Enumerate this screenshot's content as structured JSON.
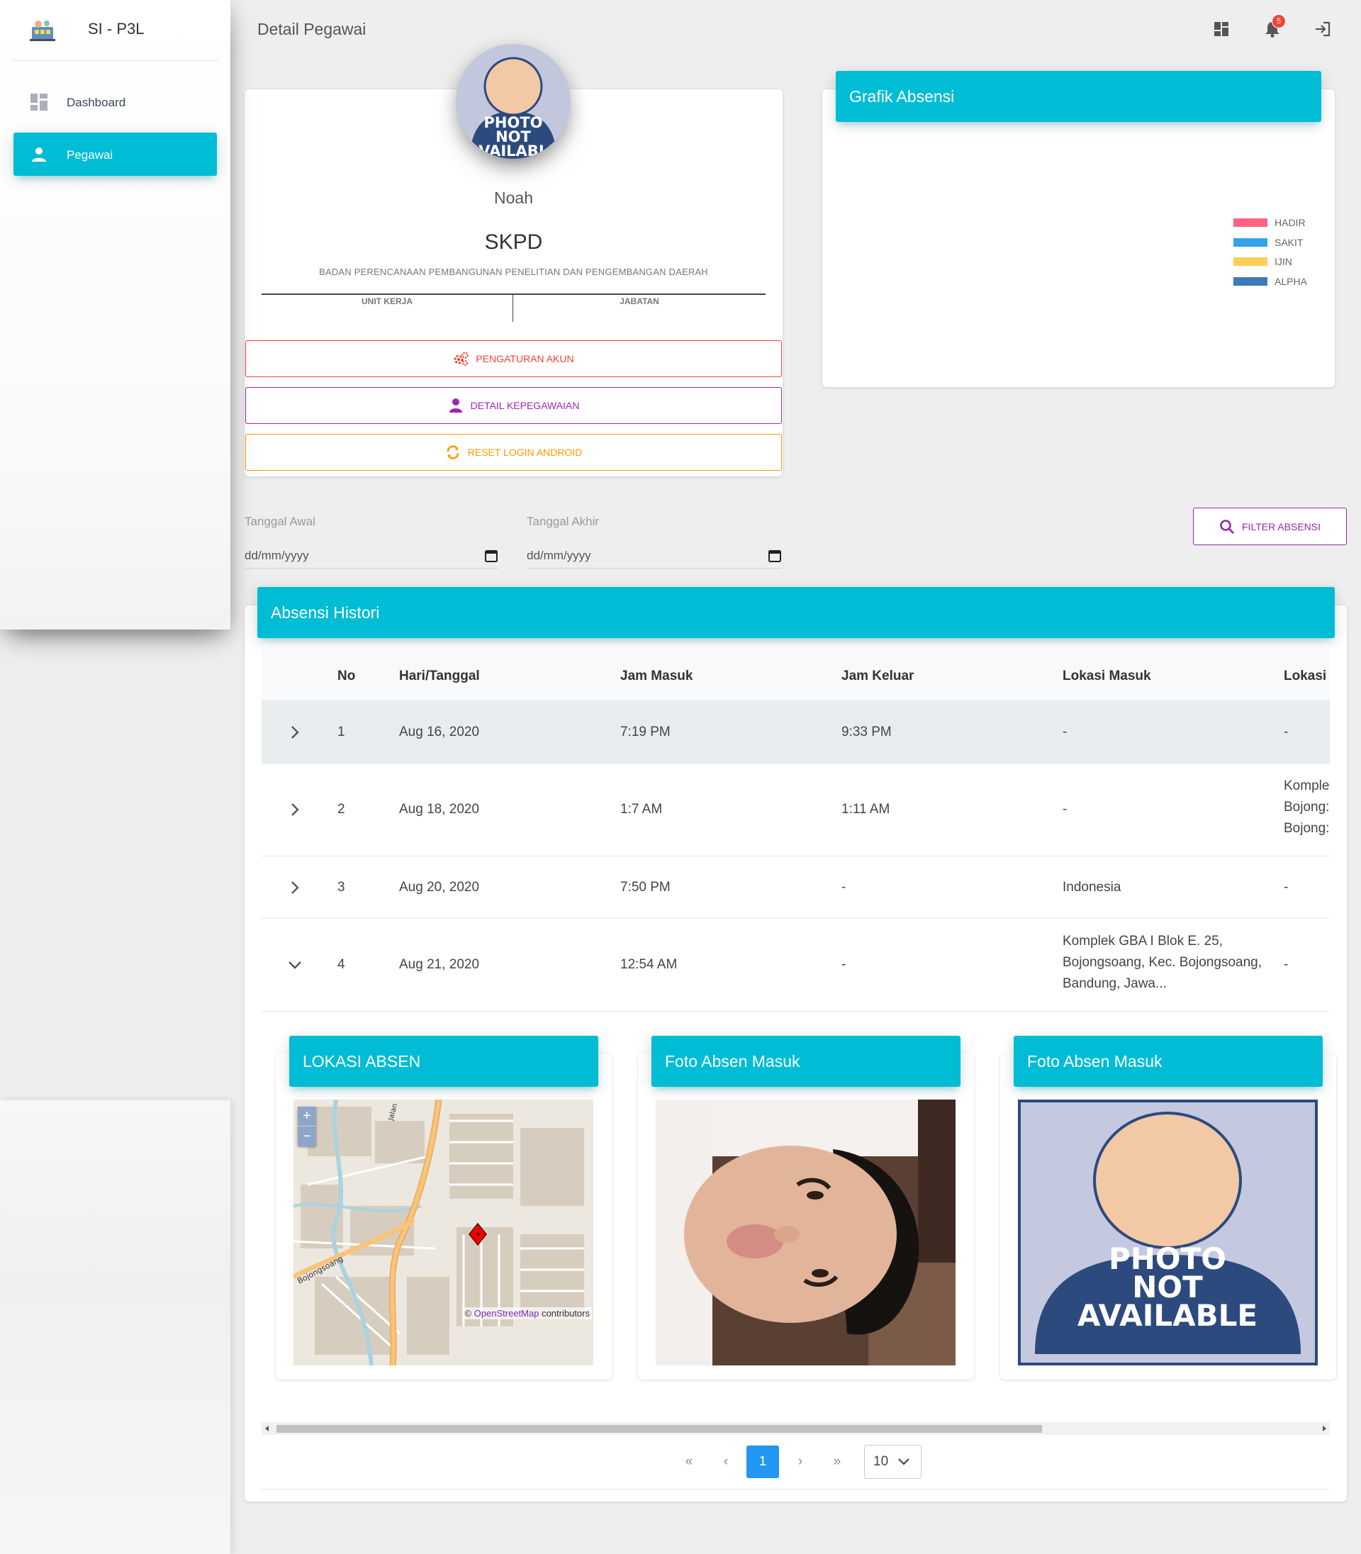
{
  "app": {
    "name": "SI - P3L"
  },
  "sidebar": {
    "items": [
      {
        "label": "Dashboard",
        "icon": "dashboard-icon",
        "active": false
      },
      {
        "label": "Pegawai",
        "icon": "person-icon",
        "active": true
      }
    ]
  },
  "header": {
    "title": "Detail Pegawai",
    "notification_count": "5"
  },
  "profile": {
    "photo_text": [
      "PHOTO",
      "NOT",
      "AVAILABLE"
    ],
    "name": "Noah",
    "skpd": "SKPD",
    "organization": "BADAN PERENCANAAN PEMBANGUNAN PENELITIAN DAN PENGEMBANGAN DAERAH",
    "unit_label": "UNIT KERJA",
    "jabatan_label": "JABATAN",
    "buttons": {
      "akun": "PENGATURAN AKUN",
      "kepegawaian": "DETAIL KEPEGAWAIAN",
      "reset": "RESET LOGIN ANDROID"
    }
  },
  "chart": {
    "title": "Grafik Absensi",
    "legend": [
      {
        "label": "HADIR",
        "color": "#ff6384"
      },
      {
        "label": "SAKIT",
        "color": "#36a2eb"
      },
      {
        "label": "IJIN",
        "color": "#ffce56"
      },
      {
        "label": "ALPHA",
        "color": "#3e7ab8"
      }
    ]
  },
  "filter": {
    "start_label": "Tanggal Awal",
    "end_label": "Tanggal Akhir",
    "start_value": "dd/mm/yyyy",
    "end_value": "dd/mm/yyyy",
    "button": "FILTER ABSENSI"
  },
  "histori": {
    "title": "Absensi Histori",
    "columns": [
      "No",
      "Hari/Tanggal",
      "Jam Masuk",
      "Jam Keluar",
      "Lokasi Masuk",
      "Lokasi I"
    ],
    "rows": [
      {
        "no": "1",
        "date": "Aug 16, 2020",
        "in": "7:19 PM",
        "out": "9:33 PM",
        "loc_in": "-",
        "loc_out": "-"
      },
      {
        "no": "2",
        "date": "Aug 18, 2020",
        "in": "1:7 AM",
        "out": "1:11 AM",
        "loc_in": "-",
        "loc_out": "Komple Bojong: Bojong:"
      },
      {
        "no": "3",
        "date": "Aug 20, 2020",
        "in": "7:50 PM",
        "out": "-",
        "loc_in": "Indonesia",
        "loc_out": "-"
      },
      {
        "no": "4",
        "date": "Aug 21, 2020",
        "in": "12:54 AM",
        "out": "-",
        "loc_in": "Komplek GBA I Blok E. 25, Bojongsoang, Kec. Bojongsoang, Bandung, Jawa...",
        "loc_out": "-"
      }
    ],
    "detail": {
      "map_title": "LOKASI ABSEN",
      "map_attrib_link": "OpenStreetMap",
      "map_attrib_text": " contributors",
      "map_road_label": "Bojongsoang",
      "map_road_label2": "Jalan",
      "photo_in_title": "Foto Absen Masuk",
      "photo_out_title": "Foto Absen Masuk",
      "photo_na_text": [
        "PHOTO",
        "NOT",
        "AVAILABLE"
      ]
    },
    "pagination": {
      "first": "«",
      "prev": "‹",
      "current": "1",
      "next": "›",
      "last": "»",
      "page_size": "10"
    }
  }
}
